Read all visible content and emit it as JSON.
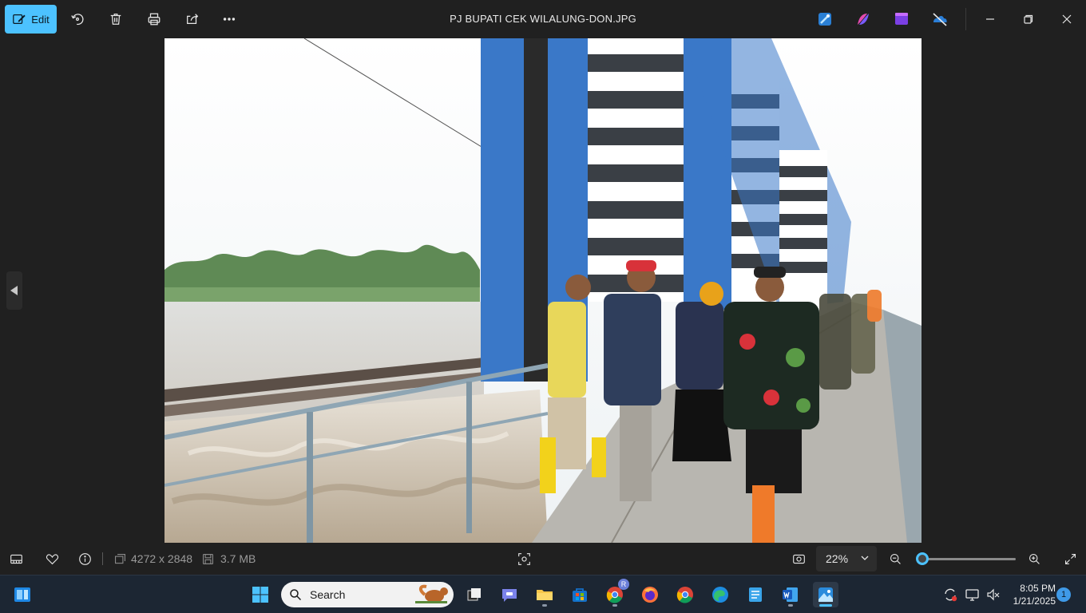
{
  "toolbar": {
    "edit_label": "Edit",
    "title": "PJ BUPATI CEK WILALUNG-DON.JPG",
    "icons": [
      "edit-icon",
      "rotate-icon",
      "delete-icon",
      "print-icon",
      "share-icon",
      "more-icon"
    ],
    "app_icons": [
      "designer-icon",
      "copilot-icon",
      "clipchamp-icon",
      "onedrive-icon"
    ],
    "window_controls": [
      "minimize-icon",
      "restore-icon",
      "close-icon"
    ]
  },
  "status": {
    "dimensions": "4272 x 2848",
    "file_size": "3.7 MB",
    "zoom": "22%",
    "zoom_level_fraction": 0.0
  },
  "taskbar": {
    "search_placeholder": "Search",
    "time": "8:05 PM",
    "date": "1/21/2025",
    "notification_count": "1",
    "chrome_badge": "R"
  },
  "colors": {
    "accent": "#4cc2ff",
    "background": "#202020",
    "taskbar": "#1c2633"
  }
}
